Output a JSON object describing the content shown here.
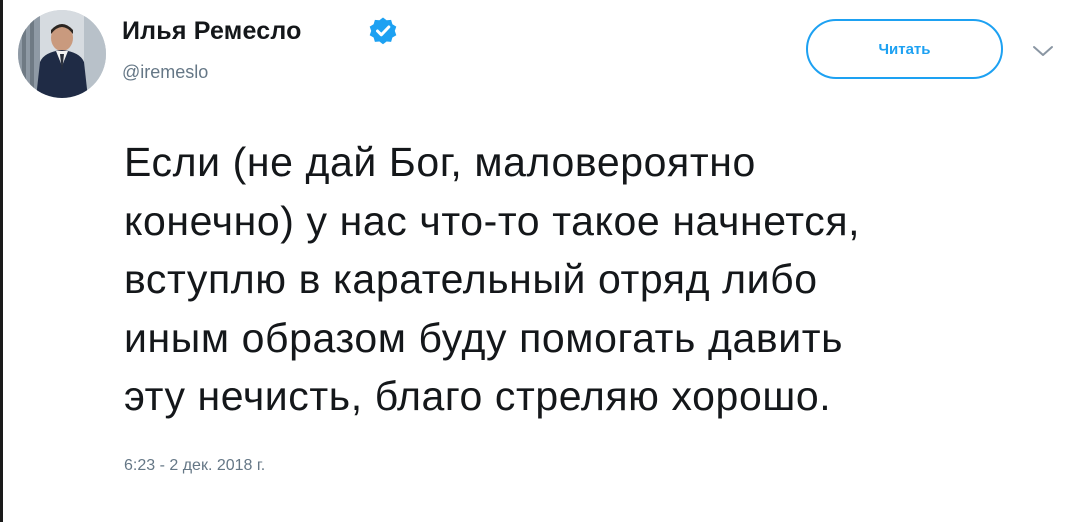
{
  "author": {
    "display_name": "Илья Ремесло",
    "handle": "@iremeslo",
    "verified": true,
    "avatar_icon": "user-photo-avatar"
  },
  "actions": {
    "follow_label": "Читать",
    "menu_icon": "chevron-down-icon"
  },
  "tweet": {
    "lines": [
      "Если (не дай Бог, маловероятно",
      "конечно) у нас что-то такое начнется,",
      "вступлю в карательный отряд либо",
      "иным образом буду помогать давить",
      "эту нечисть, благо стреляю хорошо."
    ],
    "timestamp": "6:23 - 2 дек. 2018 г."
  },
  "colors": {
    "accent": "#1da1f2",
    "text": "#14171a",
    "muted": "#657786"
  }
}
